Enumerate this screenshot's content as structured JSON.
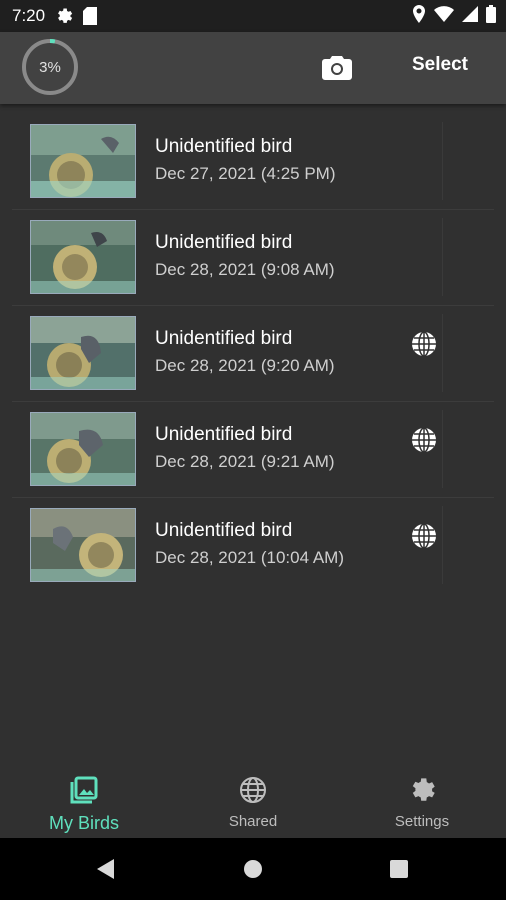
{
  "status_bar": {
    "time": "7:20"
  },
  "app_bar": {
    "progress_text": "3%",
    "progress": 0.03,
    "select_label": "Select"
  },
  "birds": [
    {
      "title": "Unidentified bird",
      "date": "Dec 27, 2021 (4:25 PM)",
      "shared": false
    },
    {
      "title": "Unidentified bird",
      "date": "Dec 28, 2021 (9:08 AM)",
      "shared": false
    },
    {
      "title": "Unidentified bird",
      "date": "Dec 28, 2021 (9:20 AM)",
      "shared": true
    },
    {
      "title": "Unidentified bird",
      "date": "Dec 28, 2021 (9:21 AM)",
      "shared": true
    },
    {
      "title": "Unidentified bird",
      "date": "Dec 28, 2021 (10:04 AM)",
      "shared": true
    }
  ],
  "bottom_nav": {
    "items": [
      {
        "label": "My Birds",
        "icon": "photo-library-icon",
        "active": true
      },
      {
        "label": "Shared",
        "icon": "globe-icon",
        "active": false
      },
      {
        "label": "Settings",
        "icon": "gear-icon",
        "active": false
      }
    ]
  },
  "colors": {
    "accent": "#5fe0bd",
    "background": "#303030",
    "appbar": "#424242"
  }
}
